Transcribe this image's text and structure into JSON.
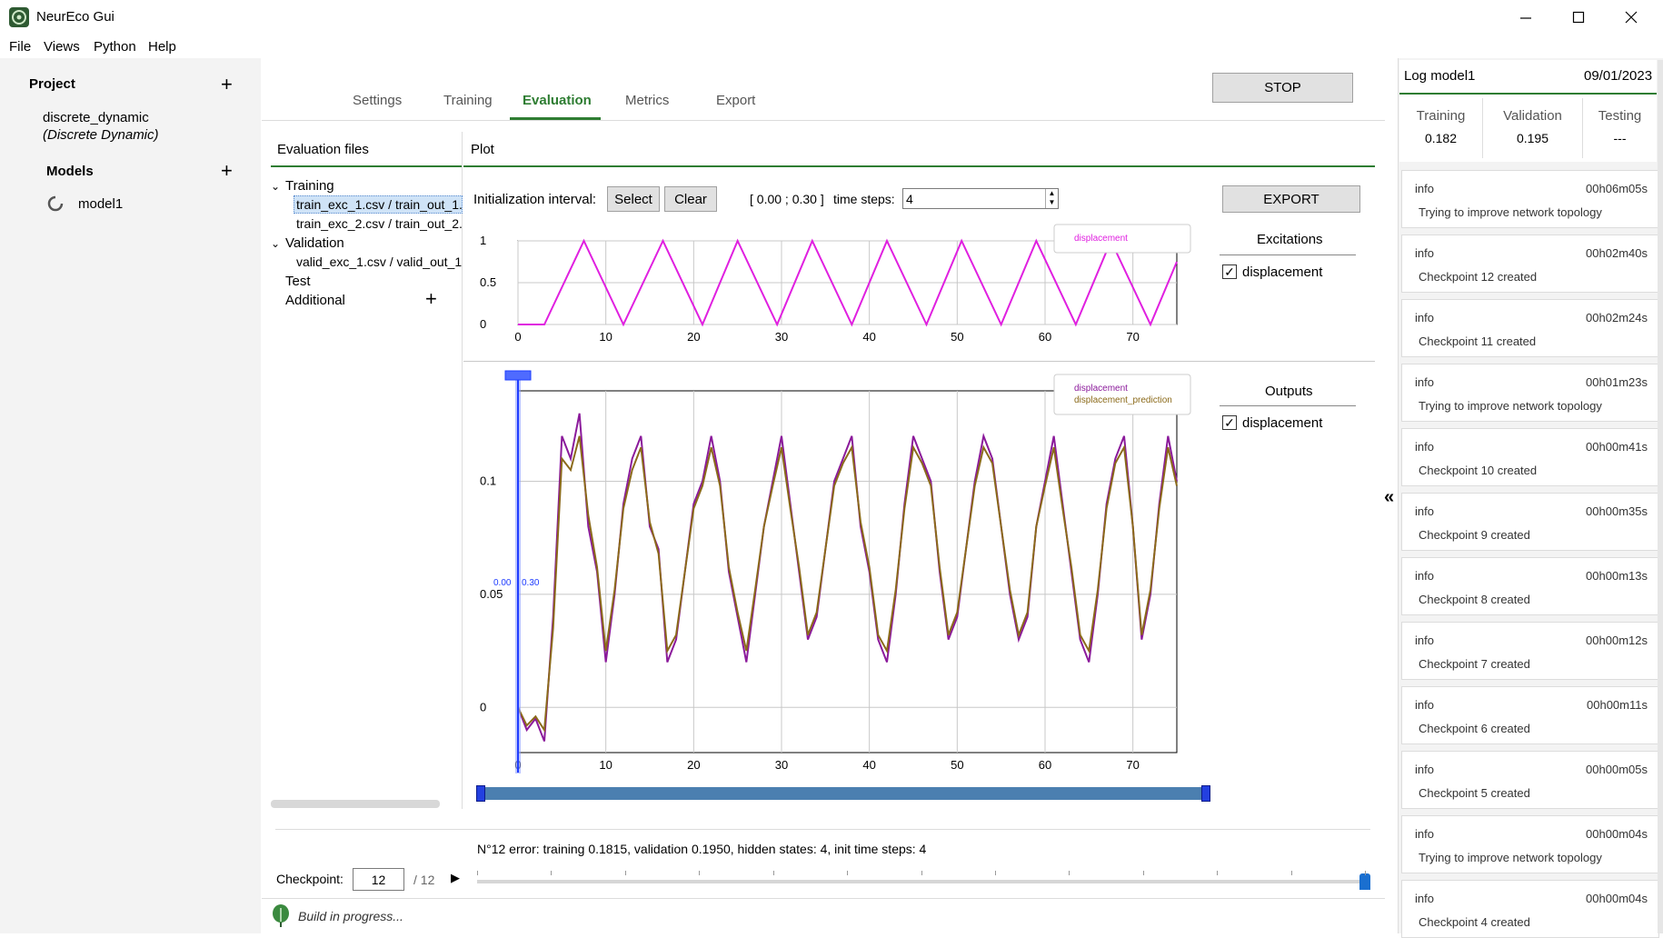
{
  "window": {
    "title": "NeurEco Gui",
    "controls": [
      "minimize-icon",
      "maximize-icon",
      "close-icon"
    ]
  },
  "menu": [
    "File",
    "Views",
    "Python",
    "Help"
  ],
  "sidebar": {
    "project_header": "Project",
    "project_name": "discrete_dynamic",
    "project_type": "(Discrete Dynamic)",
    "models_header": "Models",
    "models": [
      {
        "name": "model1",
        "icon": "spinner-icon"
      }
    ]
  },
  "tabs": [
    {
      "label": "Settings",
      "active": false
    },
    {
      "label": "Training",
      "active": false
    },
    {
      "label": "Evaluation",
      "active": true
    },
    {
      "label": "Metrics",
      "active": false
    },
    {
      "label": "Export",
      "active": false
    }
  ],
  "stop_label": "STOP",
  "eval_files": {
    "header": "Evaluation files",
    "training_label": "Training",
    "training_files": [
      "train_exc_1.csv / train_out_1.",
      "train_exc_2.csv / train_out_2."
    ],
    "validation_label": "Validation",
    "validation_files": [
      "valid_exc_1.csv / valid_out_1"
    ],
    "test_label": "Test",
    "additional_label": "Additional"
  },
  "plot": {
    "header": "Plot",
    "init_label": "Initialization interval:",
    "select_label": "Select",
    "clear_label": "Clear",
    "interval_text": "[ 0.00 ; 0.30 ]",
    "timesteps_label": "time steps:",
    "timesteps_value": "4",
    "export_label": "EXPORT",
    "excitations_header": "Excitations",
    "excitations": [
      "displacement"
    ],
    "outputs_header": "Outputs",
    "outputs": [
      "displacement"
    ],
    "marker_left": "0.00",
    "marker_right": "0.30"
  },
  "chart_data": [
    {
      "type": "line",
      "title": "",
      "xlim": [
        0,
        75
      ],
      "ylim": [
        0,
        1
      ],
      "xticks": [
        0,
        10,
        20,
        30,
        40,
        50,
        60,
        70
      ],
      "yticks": [
        "1",
        "0.5",
        "0"
      ],
      "legend": "top-right",
      "series": [
        {
          "name": "displacement",
          "color": "#e020e0",
          "x": [
            0,
            3,
            7.5,
            12,
            16.5,
            21,
            25,
            29.5,
            33.5,
            38,
            42,
            46.5,
            50.5,
            55,
            59,
            63.5,
            67.5,
            72,
            75
          ],
          "y": [
            0,
            0,
            1,
            0,
            1,
            0,
            1,
            0,
            1,
            0,
            1,
            0,
            1,
            0,
            1,
            0,
            1,
            0,
            0.75
          ]
        }
      ]
    },
    {
      "type": "line",
      "title": "",
      "xlim": [
        0,
        75
      ],
      "ylim": [
        -0.02,
        0.14
      ],
      "xticks": [
        0,
        10,
        20,
        30,
        40,
        50,
        60,
        70
      ],
      "yticks": [
        "0.1",
        "0.05",
        "0"
      ],
      "legend": "top-right",
      "series": [
        {
          "name": "displacement",
          "color": "#8b1a9b",
          "x": [
            0,
            1,
            2,
            3,
            4,
            5,
            6,
            7,
            8,
            9,
            10,
            11,
            12,
            13,
            14,
            15,
            16,
            17,
            18,
            19,
            20,
            21,
            22,
            23,
            24,
            25,
            26,
            27,
            28,
            29,
            30,
            31,
            32,
            33,
            34,
            35,
            36,
            37,
            38,
            39,
            40,
            41,
            42,
            43,
            44,
            45,
            46,
            47,
            48,
            49,
            50,
            51,
            52,
            53,
            54,
            55,
            56,
            57,
            58,
            59,
            60,
            61,
            62,
            63,
            64,
            65,
            66,
            67,
            68,
            69,
            70,
            71,
            72,
            73,
            74,
            75
          ],
          "y": [
            0.0,
            -0.01,
            -0.005,
            -0.015,
            0.04,
            0.12,
            0.11,
            0.13,
            0.08,
            0.06,
            0.02,
            0.05,
            0.09,
            0.11,
            0.12,
            0.08,
            0.07,
            0.02,
            0.03,
            0.06,
            0.09,
            0.1,
            0.12,
            0.1,
            0.06,
            0.04,
            0.02,
            0.05,
            0.08,
            0.1,
            0.12,
            0.09,
            0.06,
            0.03,
            0.04,
            0.07,
            0.1,
            0.11,
            0.12,
            0.08,
            0.06,
            0.03,
            0.02,
            0.05,
            0.09,
            0.12,
            0.11,
            0.1,
            0.06,
            0.03,
            0.04,
            0.07,
            0.1,
            0.12,
            0.11,
            0.08,
            0.05,
            0.03,
            0.04,
            0.08,
            0.1,
            0.12,
            0.09,
            0.06,
            0.03,
            0.02,
            0.05,
            0.09,
            0.11,
            0.12,
            0.08,
            0.03,
            0.05,
            0.09,
            0.12,
            0.1
          ]
        },
        {
          "name": "displacement_prediction",
          "color": "#8b6a1a",
          "x": [
            0,
            1,
            2,
            3,
            4,
            5,
            6,
            7,
            8,
            9,
            10,
            11,
            12,
            13,
            14,
            15,
            16,
            17,
            18,
            19,
            20,
            21,
            22,
            23,
            24,
            25,
            26,
            27,
            28,
            29,
            30,
            31,
            32,
            33,
            34,
            35,
            36,
            37,
            38,
            39,
            40,
            41,
            42,
            43,
            44,
            45,
            46,
            47,
            48,
            49,
            50,
            51,
            52,
            53,
            54,
            55,
            56,
            57,
            58,
            59,
            60,
            61,
            62,
            63,
            64,
            65,
            66,
            67,
            68,
            69,
            70,
            71,
            72,
            73,
            74,
            75
          ],
          "y": [
            0.0,
            -0.008,
            -0.004,
            -0.01,
            0.035,
            0.11,
            0.105,
            0.12,
            0.085,
            0.062,
            0.025,
            0.052,
            0.088,
            0.105,
            0.115,
            0.082,
            0.068,
            0.025,
            0.032,
            0.06,
            0.088,
            0.098,
            0.115,
            0.098,
            0.062,
            0.042,
            0.025,
            0.052,
            0.08,
            0.098,
            0.115,
            0.088,
            0.062,
            0.032,
            0.042,
            0.07,
            0.098,
            0.108,
            0.115,
            0.082,
            0.062,
            0.032,
            0.025,
            0.052,
            0.088,
            0.115,
            0.108,
            0.098,
            0.062,
            0.032,
            0.042,
            0.07,
            0.098,
            0.115,
            0.108,
            0.08,
            0.052,
            0.032,
            0.042,
            0.08,
            0.098,
            0.115,
            0.088,
            0.062,
            0.032,
            0.025,
            0.052,
            0.088,
            0.108,
            0.115,
            0.08,
            0.032,
            0.052,
            0.088,
            0.115,
            0.098
          ]
        }
      ]
    }
  ],
  "status": {
    "error_text": "N°12 error: training 0.1815, validation 0.1950, hidden states: 4, init time steps: 4",
    "checkpoint_label": "Checkpoint:",
    "checkpoint_value": "12",
    "checkpoint_total": "/ 12",
    "progress": 1.0,
    "build_text": "Build in progress..."
  },
  "log": {
    "title": "Log model1",
    "date": "09/01/2023",
    "training_label": "Training",
    "training_value": "0.182",
    "validation_label": "Validation",
    "validation_value": "0.195",
    "testing_label": "Testing",
    "testing_value": "---",
    "entries": [
      {
        "level": "info",
        "time": "00h06m05s",
        "msg": "Trying to improve network topology"
      },
      {
        "level": "info",
        "time": "00h02m40s",
        "msg": "Checkpoint 12 created"
      },
      {
        "level": "info",
        "time": "00h02m24s",
        "msg": "Checkpoint 11 created"
      },
      {
        "level": "info",
        "time": "00h01m23s",
        "msg": "Trying to improve network topology"
      },
      {
        "level": "info",
        "time": "00h00m41s",
        "msg": "Checkpoint 10 created"
      },
      {
        "level": "info",
        "time": "00h00m35s",
        "msg": "Checkpoint 9 created"
      },
      {
        "level": "info",
        "time": "00h00m13s",
        "msg": "Checkpoint 8 created"
      },
      {
        "level": "info",
        "time": "00h00m12s",
        "msg": "Checkpoint 7 created"
      },
      {
        "level": "info",
        "time": "00h00m11s",
        "msg": "Checkpoint 6 created"
      },
      {
        "level": "info",
        "time": "00h00m05s",
        "msg": "Checkpoint 5 created"
      },
      {
        "level": "info",
        "time": "00h00m04s",
        "msg": "Trying to improve network topology"
      },
      {
        "level": "info",
        "time": "00h00m04s",
        "msg": "Checkpoint 4 created"
      }
    ]
  }
}
